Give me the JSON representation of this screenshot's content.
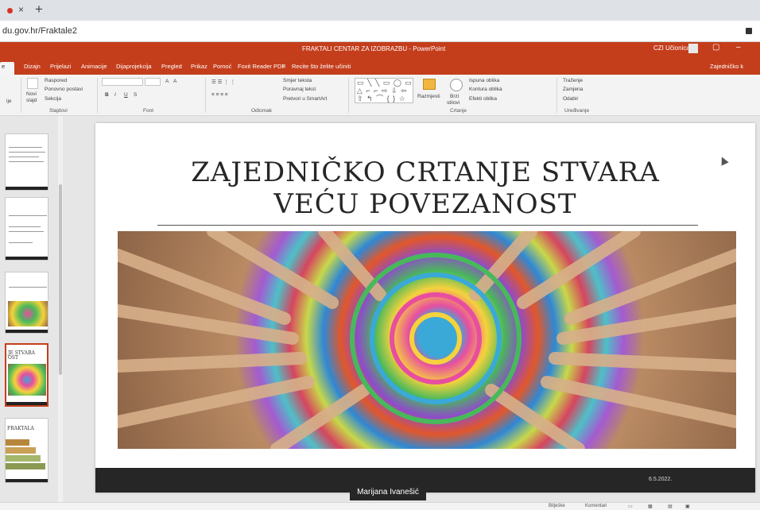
{
  "browser": {
    "tab_close": "×",
    "new_tab": "+",
    "url": "du.gov.hr/Fraktale2",
    "accent": "#d93025"
  },
  "app": {
    "document_title": "FRAKTALI CENTAR ZA IZOBRAZBU - PowerPoint",
    "user": "CZI Učionica",
    "minimize": "–",
    "restore": "▢",
    "brand_color": "#c43e1c"
  },
  "ribbon_tabs": {
    "first": "e",
    "items": [
      "Dizajn",
      "Prijelazi",
      "Animacije",
      "Dijaprojekcija",
      "Pregled",
      "Prikaz",
      "Pomoć",
      "Foxit Reader PDF"
    ],
    "tell_me": "Recite što želite učiniti",
    "share": "Zajedničko k"
  },
  "ribbon": {
    "slides_group": {
      "cut_label": "ije",
      "new_slide": "Novi",
      "new_slide_2": "slajd",
      "layout": "Raspored",
      "reset": "Ponovno postavi",
      "section": "Sekcija",
      "label": "Slajdovi"
    },
    "font_group": {
      "bold": "B",
      "italic": "I",
      "underline": "U",
      "strike": "S",
      "grow": "A",
      "shrink": "A",
      "label": "Font"
    },
    "paragraph_group": {
      "text_direction": "Smjer teksta",
      "align_text": "Poravnaj tekst",
      "smartart": "Pretvori u SmartArt",
      "label": "Odlomak"
    },
    "drawing_group": {
      "shapes": "▭ ╲ ╲ ▭ ◯ ▭ △ ⌐ ⌐ ⇨ ⇩ ⇦ ⇧ ↰ ⌒ { } ☆",
      "arrange": "Razmjesti",
      "quick_styles": "Brzi",
      "quick_styles_2": "stilovi",
      "fill": "Ispuna oblika",
      "outline": "Kontura oblika",
      "effects": "Efekti oblika",
      "label": "Crtanje"
    },
    "editing_group": {
      "find": "Traženje",
      "replace": "Zamjena",
      "select": "Odabir",
      "label": "Uređivanje"
    }
  },
  "thumbnails": [
    {
      "text": ""
    },
    {
      "text": ""
    },
    {
      "text": ""
    },
    {
      "text": "JE STVARA\nOST",
      "selected": true
    },
    {
      "text": "FRAKTALA"
    }
  ],
  "slide": {
    "title_line1": "ZAJEDNIČKO CRTANJE STVARA",
    "title_line2": "VEĆU POVEZANOST",
    "date": "6.5.2022."
  },
  "caption": "Marijana Ivanešić",
  "statusbar": {
    "notes": "Bilješke",
    "comments": "Komentari"
  }
}
